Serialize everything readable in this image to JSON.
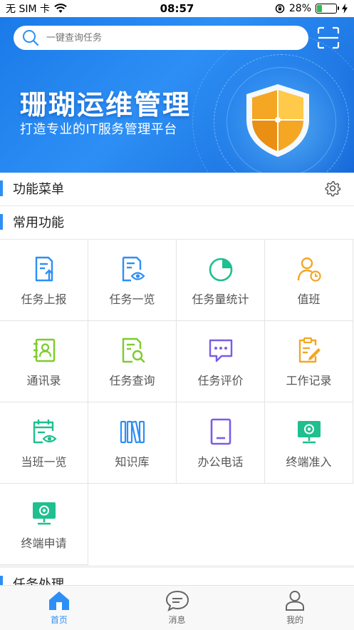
{
  "status_bar": {
    "carrier": "无 SIM 卡",
    "time": "08:57",
    "battery_percent": "28%",
    "battery_level": 0.28
  },
  "search": {
    "placeholder": "一键查询任务"
  },
  "banner": {
    "title": "珊瑚运维管理",
    "subtitle": "打造专业的IT服务管理平台"
  },
  "sections": {
    "menu_title": "功能菜单",
    "common_title": "常用功能",
    "task_title": "任务处理"
  },
  "functions": [
    {
      "label": "任务上报",
      "icon": "task-report-icon",
      "color": "#2d8ff5"
    },
    {
      "label": "任务一览",
      "icon": "task-overview-icon",
      "color": "#2d8ff5"
    },
    {
      "label": "任务量统计",
      "icon": "pie-chart-icon",
      "color": "#1fbf8f"
    },
    {
      "label": "值班",
      "icon": "duty-person-icon",
      "color": "#f5a623"
    },
    {
      "label": "通讯录",
      "icon": "contacts-icon",
      "color": "#7ccc2c"
    },
    {
      "label": "任务查询",
      "icon": "task-search-icon",
      "color": "#7ccc2c"
    },
    {
      "label": "任务评价",
      "icon": "comment-icon",
      "color": "#7b5ce8"
    },
    {
      "label": "工作记录",
      "icon": "work-record-icon",
      "color": "#f5a623"
    },
    {
      "label": "当班一览",
      "icon": "calendar-view-icon",
      "color": "#1fbf8f"
    },
    {
      "label": "知识库",
      "icon": "bookshelf-icon",
      "color": "#2d8ff5"
    },
    {
      "label": "办公电话",
      "icon": "phone-icon",
      "color": "#7b5ce8"
    },
    {
      "label": "终端准入",
      "icon": "terminal-access-icon",
      "color": "#1fbf8f"
    },
    {
      "label": "终端申请",
      "icon": "terminal-apply-icon",
      "color": "#1fbf8f"
    }
  ],
  "tabbar": {
    "items": [
      {
        "label": "首页",
        "icon": "home-icon",
        "active": true
      },
      {
        "label": "消息",
        "icon": "message-icon",
        "active": false
      },
      {
        "label": "我的",
        "icon": "user-icon",
        "active": false
      }
    ]
  },
  "colors": {
    "accent": "#2d8ff5",
    "banner": "#1a7ae8",
    "green": "#1fbf8f",
    "orange": "#f5a623",
    "purple": "#7b5ce8",
    "lime": "#7ccc2c"
  }
}
